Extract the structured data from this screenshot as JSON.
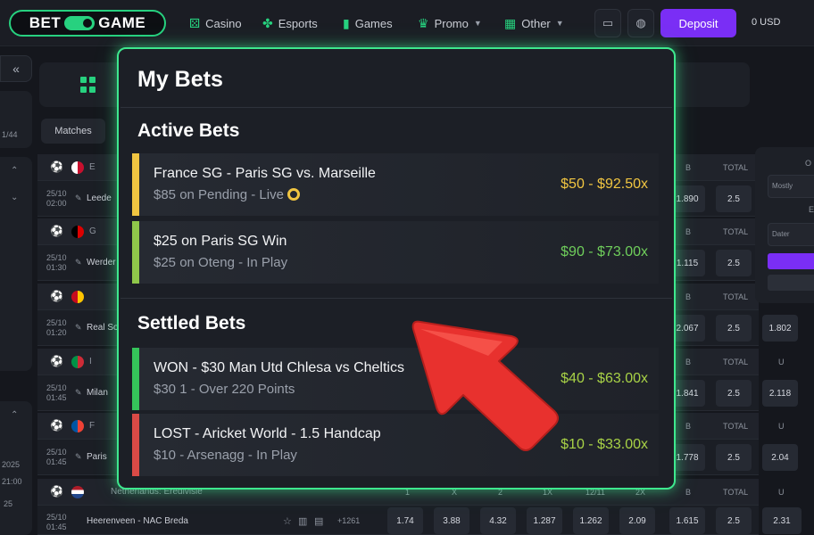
{
  "header": {
    "logo_left": "BET",
    "logo_right": "GAME",
    "nav": [
      {
        "label": "Casino",
        "icon": "dice-icon",
        "glyph": "⚄",
        "chevron": false
      },
      {
        "label": "Esports",
        "icon": "esports-icon",
        "glyph": "✤",
        "chevron": false
      },
      {
        "label": "Games",
        "icon": "cards-icon",
        "glyph": "▮",
        "chevron": false
      },
      {
        "label": "Promo",
        "icon": "crown-icon",
        "glyph": "♛",
        "chevron": true
      },
      {
        "label": "Other",
        "icon": "grid-icon",
        "glyph": "▦",
        "chevron": true
      }
    ],
    "android_glyph": "▭",
    "apple_glyph": "◍",
    "deposit_label": "Deposit",
    "balance": "0 USD"
  },
  "sidebar": {
    "collapse_glyph": "«",
    "texts": [
      "1/44",
      "2025",
      "21:00",
      "25"
    ]
  },
  "sports": {
    "matches_tab": "Matches",
    "rows": [
      {
        "team_prefix": "E",
        "time": [
          "25/10",
          "02:00"
        ],
        "team": "Leede",
        "hdr": [
          "B",
          "TOTAL"
        ],
        "odds": [
          "1.890",
          "2.5"
        ],
        "flag": [
          "#ffffff",
          "#c8102e"
        ]
      },
      {
        "team_prefix": "G",
        "time": [
          "25/10",
          "01:30"
        ],
        "team": "Werder",
        "hdr": [
          "B",
          "TOTAL"
        ],
        "odds": [
          "1.115",
          "2.5"
        ],
        "flag": [
          "#000000",
          "#dd0000"
        ]
      },
      {
        "team_prefix": "",
        "time": [
          "25/10",
          "01:20"
        ],
        "team": "Real So",
        "hdr": [
          "B",
          "TOTAL"
        ],
        "odds": [
          "2.067",
          "2.5",
          "1.802"
        ],
        "flag": [
          "#c60b1e",
          "#ffc400"
        ]
      },
      {
        "team_prefix": "I",
        "time": [
          "25/10",
          "01:45"
        ],
        "team": "Milan",
        "hdr": [
          "B",
          "TOTAL",
          "U"
        ],
        "odds": [
          "1.841",
          "2.5",
          "2.118"
        ],
        "flag": [
          "#009246",
          "#ce2b37"
        ]
      },
      {
        "team_prefix": "F",
        "time": [
          "25/10",
          "01:45"
        ],
        "team": "Paris",
        "hdr": [
          "B",
          "TOTAL",
          "U"
        ],
        "odds": [
          "1.778",
          "2.5",
          "2.04"
        ],
        "flag": [
          "#0055a4",
          "#ef4135"
        ]
      }
    ],
    "last_row": {
      "league": "Netherlands: Eredivisie",
      "time": [
        "25/10",
        "01:45"
      ],
      "match": "Heerenveen - NAC Breda",
      "more": "+1261",
      "headers": [
        "1",
        "X",
        "2",
        "1X",
        "12/11",
        "2X",
        "B",
        "TOTAL",
        "U"
      ],
      "odds": [
        "1.74",
        "3.88",
        "4.32",
        "1.287",
        "1.262",
        "2.09",
        "1.615",
        "2.5",
        "2.31"
      ]
    }
  },
  "right_panel": {
    "fields": [
      "Mostly",
      "Dater"
    ],
    "label_top": "O",
    "label_mid": "E"
  },
  "mybets": {
    "title": "My Bets",
    "active_title": "Active Bets",
    "settled_title": "Settled Bets",
    "active": [
      {
        "line1": "France SG - Paris SG vs. Marseille",
        "line2": "$85 on Pending - Live",
        "amount": "$50 - $92.50x",
        "accent": "#f0c541",
        "amount_color": "#f0c541",
        "live": true
      },
      {
        "line1": "$25 on Paris SG Win",
        "line2": "$25 on Oteng - In Play",
        "amount": "$90 - $73.00x",
        "accent": "#8fc74a",
        "amount_color": "#6fce5b",
        "live": false
      }
    ],
    "settled": [
      {
        "line1": "WON - $30 Man Utd Chlesa vs Cheltics",
        "line2": "$30 1 - Over 220 Points",
        "amount": "$40 - $63.00x",
        "accent": "#35c45a",
        "amount_color": "#a8d246"
      },
      {
        "line1": "LOST - Aricket World - 1.5 Handcap",
        "line2": "$10 - Arsenagg - In Play",
        "amount": "$10 - $33.00x",
        "accent": "#d94a46",
        "amount_color": "#a8d246"
      }
    ]
  },
  "colors": {
    "accent_green": "#27d17f",
    "deposit_purple": "#7a2ef5",
    "arrow_red": "#e8312e"
  }
}
